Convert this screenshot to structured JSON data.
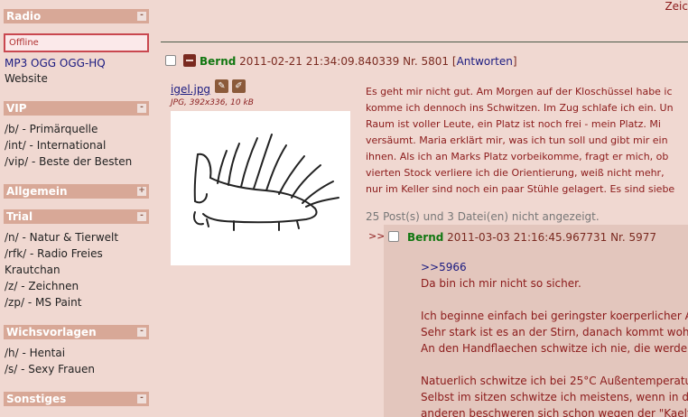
{
  "top": {
    "partial_link": "Zeic"
  },
  "sidebar": {
    "radio": {
      "title": "Radio",
      "toggle": "-",
      "status": "Offline",
      "links": "MP3 OGG OGG-HQ",
      "website": "Website"
    },
    "sections": [
      {
        "title": "VIP",
        "toggle": "-",
        "items": [
          "/b/ - Primärquelle",
          "/int/ - International",
          "/vip/ - Beste der Besten"
        ]
      },
      {
        "title": "Allgemein",
        "toggle": "+",
        "items": []
      },
      {
        "title": "Trial",
        "toggle": "-",
        "items": [
          "/n/ - Natur & Tierwelt",
          "/rfk/ - Radio Freies",
          "Krautchan",
          "/z/ - Zeichnen",
          "/zp/ - MS Paint"
        ]
      },
      {
        "title": "Wichsvorlagen",
        "toggle": "-",
        "items": [
          "/h/ - Hentai",
          "/s/ - Sexy Frauen"
        ]
      },
      {
        "title": "Sonstiges",
        "toggle": "-",
        "items": []
      }
    ]
  },
  "op": {
    "name": "Bernd",
    "datetime": "2011-02-21 21:34:09.840339",
    "number": "Nr. 5801",
    "reply_label": "Antworten",
    "file": {
      "name": "igel.jpg",
      "info": "JPG, 392x336, 10 kB"
    },
    "lines": [
      "Es geht mir nicht gut. Am Morgen auf der Kloschüssel habe ic",
      "komme ich dennoch ins Schwitzen. Im Zug schlafe ich ein. Un",
      "Raum ist voller Leute, ein Platz ist noch frei - mein Platz. Mi",
      "versäumt. Maria erklärt mir, was ich tun soll und gibt mir ein",
      "ihnen. Als ich an Marks Platz vorbeikomme, fragt er mich, ob",
      "vierten Stock verliere ich die Orientierung, weiß nicht mehr,",
      "nur im Keller sind noch ein paar Stühle gelagert. Es sind siebe"
    ],
    "omitted": "25 Post(s) und 3 Datei(en) nicht angezeigt."
  },
  "reply": {
    "arrow": ">>",
    "name": "Bernd",
    "datetime": "2011-03-03 21:16:45.967731",
    "number": "Nr. 5977",
    "quote": ">>5966",
    "lines": [
      "Da bin ich mir nicht so sicher.",
      "",
      "Ich beginne einfach bei geringster koerperlicher A",
      "Sehr stark ist es an der Stirn, danach kommt wohl",
      "An den Handflaechen schwitze ich nie, die werden",
      "",
      "Natuerlich schwitze ich bei 25°C Außentemperatur",
      "Selbst im sitzen schwitze ich meistens, wenn in de",
      "anderen beschweren sich schon wegen der \"Kaelte\""
    ]
  }
}
